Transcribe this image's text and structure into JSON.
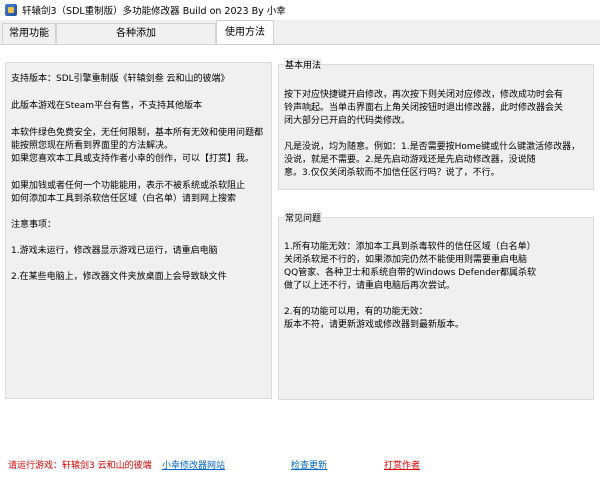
{
  "window": {
    "title": "轩辕剑3（SDL重制版）多功能修改器  Build on 2023 By 小幸"
  },
  "tabs": [
    {
      "label": "常用功能"
    },
    {
      "label": "各种添加"
    },
    {
      "label": "使用方法"
    }
  ],
  "left_panel": {
    "lines": [
      "支持版本：SDL引擎重制版《轩辕剑叁 云和山的彼端》",
      "此版本游戏在Steam平台有售，不支持其他版本",
      "本软件绿色免费安全，无任何限制，基本所有无效和使用问题都",
      "能按照您现在所看到界面里的方法解决。",
      "如果您喜欢本工具或支持作者小幸的创作，可以【打赏】我。",
      "如果加钱或者任何一个功能能用，表示不被系统或杀软阻止",
      "如何添加本工具到杀软信任区域（白名单）请到网上搜索",
      "注意事项：",
      "1.游戏未运行，修改器显示游戏已运行，请重启电脑",
      "2.在某些电脑上，修改器文件夹放桌面上会导致缺文件"
    ]
  },
  "basic_usage": {
    "title": "基本用法",
    "lines": [
      "按下对应快捷键开启修改，再次按下则关闭对应修改，修改成功时会有",
      "铃声响起。当单击界面右上角关闭按钮时退出修改器，此时修改器会关",
      "闭大部分已开启的代码类修改。",
      "凡是没说，均为随意。例如：1.是否需要按Home键或什么键激活修改器，",
      "没说，就是不需要。2.是先启动游戏还是先启动修改器，没说随",
      "意。3.仅仅关闭杀软而不加信任区行吗？说了，不行。"
    ]
  },
  "faq": {
    "title": "常见问题",
    "lines": [
      "1.所有功能无效：添加本工具到杀毒软件的信任区域（白名单）",
      "  关闭杀软是不行的，如果添加完仍然不能使用则需要重启电脑",
      "  QQ管家、各种卫士和系统自带的Windows Defender都属杀软",
      "  做了以上还不行，请重启电脑后再次尝试。",
      "2.有的功能可以用，有的功能无效：",
      "  版本不符，请更新游戏或修改器到最新版本。"
    ]
  },
  "footer": {
    "game_status": "请运行游戏：轩辕剑3 云和山的彼端",
    "website_link": "小幸修改器网站",
    "check_update": "检查更新",
    "donate": "打赏作者"
  }
}
